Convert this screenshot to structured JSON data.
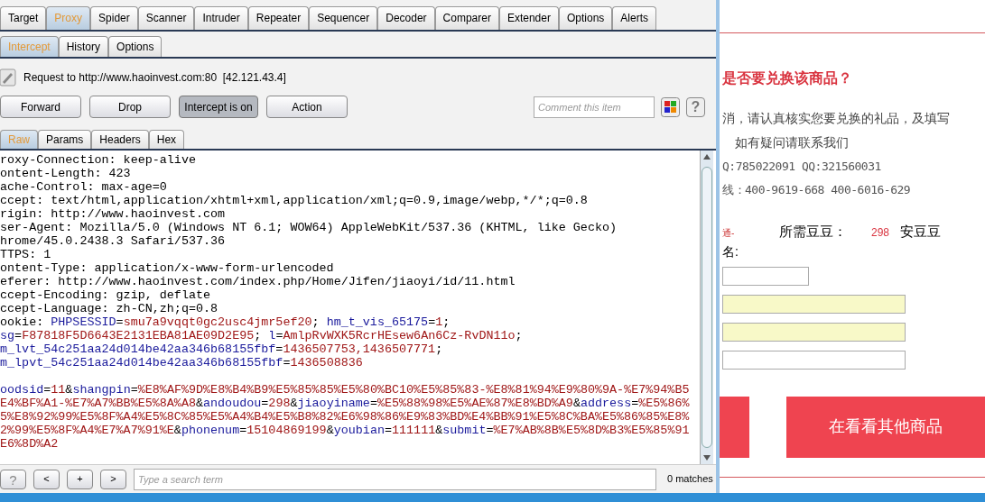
{
  "tool_tabs": [
    {
      "label": "Target",
      "selected": false
    },
    {
      "label": "Proxy",
      "selected": true
    },
    {
      "label": "Spider",
      "selected": false
    },
    {
      "label": "Scanner",
      "selected": false
    },
    {
      "label": "Intruder",
      "selected": false
    },
    {
      "label": "Repeater",
      "selected": false
    },
    {
      "label": "Sequencer",
      "selected": false
    },
    {
      "label": "Decoder",
      "selected": false
    },
    {
      "label": "Comparer",
      "selected": false
    },
    {
      "label": "Extender",
      "selected": false
    },
    {
      "label": "Options",
      "selected": false
    },
    {
      "label": "Alerts",
      "selected": false
    }
  ],
  "proxy_tabs": [
    {
      "label": "Intercept",
      "selected": true
    },
    {
      "label": "History",
      "selected": false
    },
    {
      "label": "Options",
      "selected": false
    }
  ],
  "request_line": {
    "label": "Request to http://www.haoinvest.com:80",
    "address": "[42.121.43.4]"
  },
  "actions": [
    {
      "label": "Forward",
      "kind": "button"
    },
    {
      "label": "Drop",
      "kind": "button"
    },
    {
      "label": "Intercept is on",
      "kind": "toggle",
      "on": true
    },
    {
      "label": "Action",
      "kind": "button"
    }
  ],
  "comment": {
    "placeholder": "Comment this item"
  },
  "help_label": "?",
  "message_tabs": [
    {
      "label": "Raw",
      "selected": true
    },
    {
      "label": "Params",
      "selected": false
    },
    {
      "label": "Headers",
      "selected": false
    },
    {
      "label": "Hex",
      "selected": false
    }
  ],
  "request_lines": [
    [
      {
        "kind": "plain",
        "text": "roxy-Connection: keep-alive"
      }
    ],
    [
      {
        "kind": "plain",
        "text": "ontent-Length: 423"
      }
    ],
    [
      {
        "kind": "plain",
        "text": "ache-Control: max-age=0"
      }
    ],
    [
      {
        "kind": "plain",
        "text": "ccept: text/html,application/xhtml+xml,application/xml;q=0.9,image/webp,*/*;q=0.8"
      }
    ],
    [
      {
        "kind": "plain",
        "text": "rigin: http://www.haoinvest.com"
      }
    ],
    [
      {
        "kind": "plain",
        "text": "ser-Agent: Mozilla/5.0 (Windows NT 6.1; WOW64) AppleWebKit/537.36 (KHTML, like Gecko)"
      }
    ],
    [
      {
        "kind": "plain",
        "text": "hrome/45.0.2438.3 Safari/537.36"
      }
    ],
    [
      {
        "kind": "plain",
        "text": "TTPS: 1"
      }
    ],
    [
      {
        "kind": "plain",
        "text": "ontent-Type: application/x-www-form-urlencoded"
      }
    ],
    [
      {
        "kind": "plain",
        "text": "eferer: http://www.haoinvest.com/index.php/Home/Jifen/jiaoyi/id/11.html"
      }
    ],
    [
      {
        "kind": "plain",
        "text": "ccept-Encoding: gzip, deflate"
      }
    ],
    [
      {
        "kind": "plain",
        "text": "ccept-Language: zh-CN,zh;q=0.8"
      }
    ],
    [
      {
        "kind": "plain",
        "text": "ookie: "
      },
      {
        "kind": "name",
        "text": "PHPSESSID"
      },
      {
        "kind": "plain",
        "text": "="
      },
      {
        "kind": "value",
        "text": "smu7a9vqqt0gc2usc4jmr5ef20"
      },
      {
        "kind": "plain",
        "text": "; "
      },
      {
        "kind": "name",
        "text": "hm_t_vis_65175"
      },
      {
        "kind": "plain",
        "text": "="
      },
      {
        "kind": "value",
        "text": "1"
      },
      {
        "kind": "plain",
        "text": ";"
      }
    ],
    [
      {
        "kind": "name",
        "text": "sg"
      },
      {
        "kind": "plain",
        "text": "="
      },
      {
        "kind": "value",
        "text": "F87818F5D6643E2131EBA81AE09D2E95"
      },
      {
        "kind": "plain",
        "text": "; "
      },
      {
        "kind": "name",
        "text": "l"
      },
      {
        "kind": "plain",
        "text": "="
      },
      {
        "kind": "value",
        "text": "AmlpRvWXK5RcrHEsew6An6Cz-RvDN11o"
      },
      {
        "kind": "plain",
        "text": ";"
      }
    ],
    [
      {
        "kind": "name",
        "text": "m_lvt_54c251aa24d014be42aa346b68155fbf"
      },
      {
        "kind": "plain",
        "text": "="
      },
      {
        "kind": "value",
        "text": "1436507753,1436507771"
      },
      {
        "kind": "plain",
        "text": ";"
      }
    ],
    [
      {
        "kind": "name",
        "text": "m_lpvt_54c251aa24d014be42aa346b68155fbf"
      },
      {
        "kind": "plain",
        "text": "="
      },
      {
        "kind": "value",
        "text": "1436508836"
      }
    ]
  ],
  "request_body": [
    [
      {
        "kind": "name",
        "text": "oodsid"
      },
      {
        "kind": "plain",
        "text": "="
      },
      {
        "kind": "value",
        "text": "11"
      },
      {
        "kind": "plain",
        "text": "&"
      },
      {
        "kind": "name",
        "text": "shangpin"
      },
      {
        "kind": "plain",
        "text": "="
      },
      {
        "kind": "value",
        "text": "%E8%AF%9D%E8%B4%B9%E5%85%85%E5%80%BC10%E5%85%83-%E8%81%94%E9%80%9A-%E7%94%B5"
      }
    ],
    [
      {
        "kind": "value",
        "text": "E4%BF%A1-%E7%A7%BB%E5%8A%A8"
      },
      {
        "kind": "plain",
        "text": "&"
      },
      {
        "kind": "name",
        "text": "andoudou"
      },
      {
        "kind": "plain",
        "text": "="
      },
      {
        "kind": "value",
        "text": "298"
      },
      {
        "kind": "plain",
        "text": "&"
      },
      {
        "kind": "name",
        "text": "jiaoyiname"
      },
      {
        "kind": "plain",
        "text": "="
      },
      {
        "kind": "value",
        "text": "%E5%88%98%E5%AE%87%E8%BD%A9"
      },
      {
        "kind": "plain",
        "text": "&"
      },
      {
        "kind": "name",
        "text": "address"
      },
      {
        "kind": "plain",
        "text": "="
      },
      {
        "kind": "value",
        "text": "%E5%86%"
      }
    ],
    [
      {
        "kind": "value",
        "text": "5%E8%92%99%E5%8F%A4%E5%8C%85%E5%A4%B4%E5%B8%82%E6%98%86%E9%83%BD%E4%BB%91%E5%8C%BA%E5%86%85%E8%"
      }
    ],
    [
      {
        "kind": "value",
        "text": "2%99%E5%8F%A4%E7%A7%91%E"
      },
      {
        "kind": "plain",
        "text": "&"
      },
      {
        "kind": "name",
        "text": "phonenum"
      },
      {
        "kind": "plain",
        "text": "="
      },
      {
        "kind": "value",
        "text": "15104869199"
      },
      {
        "kind": "plain",
        "text": "&"
      },
      {
        "kind": "name",
        "text": "youbian"
      },
      {
        "kind": "plain",
        "text": "="
      },
      {
        "kind": "value",
        "text": "111111"
      },
      {
        "kind": "plain",
        "text": "&"
      },
      {
        "kind": "name",
        "text": "submit"
      },
      {
        "kind": "plain",
        "text": "="
      },
      {
        "kind": "value",
        "text": "%E7%AB%8B%E5%8D%B3%E5%85%91"
      }
    ],
    [
      {
        "kind": "value",
        "text": "E6%8D%A2"
      }
    ]
  ],
  "search": {
    "buttons": [
      "?",
      "<",
      "+",
      ">"
    ],
    "placeholder": "Type a search term",
    "matches": "0 matches"
  },
  "web_page": {
    "title": "是否要兑换该商品？",
    "notice": [
      "消，请认真核实您要兑换的礼品，及填写",
      "如有疑问请联系我们"
    ],
    "contacts": [
      "Q:785022091 QQ:321560031",
      "线：400-9619-668 400-6016-629"
    ],
    "product_tag": "通-",
    "cost_label": "所需豆豆：",
    "cost_value": "298",
    "cost_unit": "安豆豆",
    "name_label": "名:",
    "fields": [
      {
        "kind": "short",
        "autofilled": false
      },
      {
        "kind": "long",
        "autofilled": true
      },
      {
        "kind": "long",
        "autofilled": true
      },
      {
        "kind": "long",
        "autofilled": false
      }
    ],
    "other_button": "在看看其他商品"
  }
}
